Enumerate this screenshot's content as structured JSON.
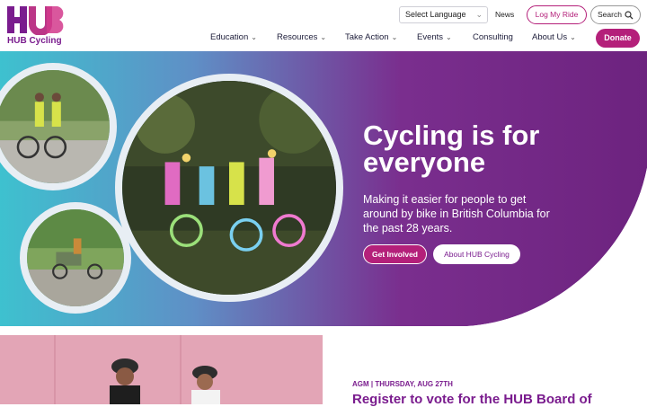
{
  "brand": {
    "name": "HUB Cycling",
    "accent": "#b4207a",
    "purple": "#7a1c8e"
  },
  "utility": {
    "language_label": "Select Language",
    "news_label": "News",
    "login_label": "Log My Ride",
    "search_label": "Search"
  },
  "nav": {
    "items": [
      {
        "label": "Education",
        "dropdown": true
      },
      {
        "label": "Resources",
        "dropdown": true
      },
      {
        "label": "Take Action",
        "dropdown": true
      },
      {
        "label": "Events",
        "dropdown": true
      },
      {
        "label": "Consulting",
        "dropdown": false
      },
      {
        "label": "About Us",
        "dropdown": true
      }
    ],
    "donate_label": "Donate"
  },
  "hero": {
    "title": "Cycling is for everyone",
    "subtitle": "Making it easier for people to get around by bike in British Columbia for the past 28 years.",
    "primary_cta": "Get Involved",
    "secondary_cta": "About HUB Cycling"
  },
  "feature": {
    "tagline": "AGM | THURSDAY, AUG 27TH",
    "title": "Register to vote for the HUB Board of"
  }
}
